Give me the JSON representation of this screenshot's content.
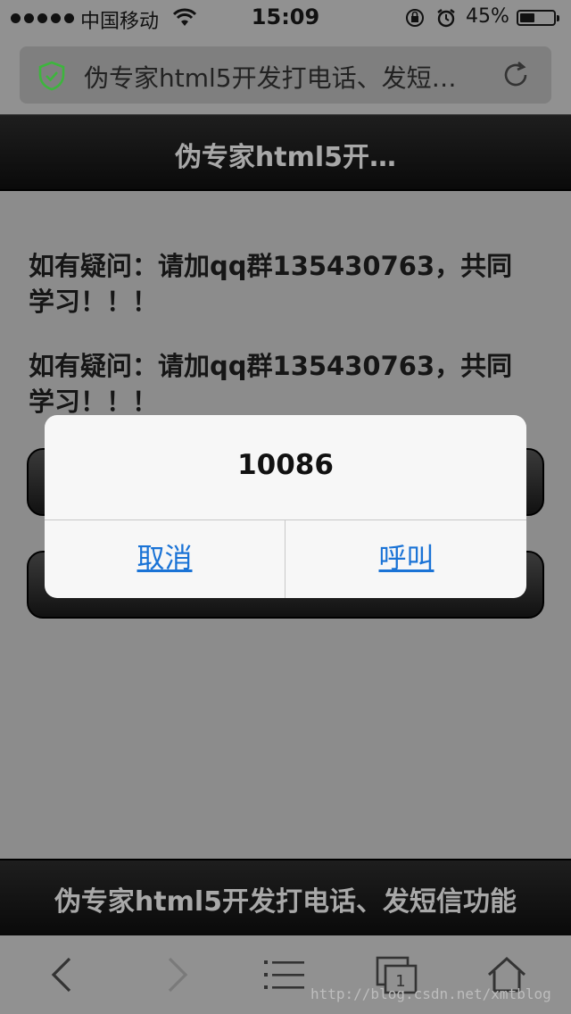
{
  "status_bar": {
    "carrier": "中国移动",
    "time": "15:09",
    "battery_percent": "45%",
    "battery_level": 0.45,
    "icons": [
      "signal-dots-icon",
      "wifi-icon",
      "rotation-lock-icon",
      "alarm-icon",
      "battery-icon"
    ]
  },
  "url_bar": {
    "text": "伪专家html5开发打电话、发短…",
    "icons": [
      "secure-shield-icon",
      "reload-icon"
    ]
  },
  "header": {
    "title": "伪专家html5开…"
  },
  "content": {
    "paragraphs": [
      "如有疑问：请加qq群135430763，共同学习！！！",
      "如有疑问：请加qq群135430763，共同学习！！！"
    ],
    "buttons": [
      "",
      ""
    ]
  },
  "dialog": {
    "message": "10086",
    "cancel_label": "取消",
    "call_label": "呼叫"
  },
  "footer": {
    "title": "伪专家html5开发打电话、发短信功能"
  },
  "toolbar": {
    "tab_count": "1",
    "icons": [
      "back-icon",
      "forward-icon",
      "bookmarks-icon",
      "tabs-icon",
      "home-icon"
    ]
  },
  "watermark": "http://blog.csdn.net/xmtblog",
  "colors": {
    "dialog_button": "#1a73d6",
    "secure_shield": "#3db53d",
    "header_bg": "#111111",
    "overlay_bg": "#8c8c8c"
  }
}
